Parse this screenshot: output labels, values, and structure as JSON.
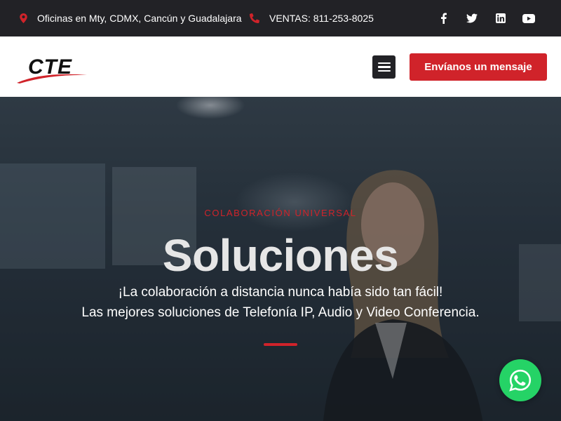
{
  "topbar": {
    "location_text": "Oficinas en Mty, CDMX, Cancún y Guadalajara",
    "phone_text": "VENTAS: 811-253-8025",
    "social": [
      "facebook-icon",
      "twitter-icon",
      "linkedin-icon",
      "youtube-icon"
    ]
  },
  "header": {
    "logo_text": "CTE",
    "cta_label": "Envíanos un mensaje"
  },
  "hero": {
    "eyebrow": "COLABORACIÓN UNIVERSAL",
    "title": "Soluciones",
    "line1": "¡La colaboración a distancia nunca había sido tan fácil!",
    "line2": "Las mejores soluciones de Telefonía IP, Audio y Video Conferencia."
  },
  "colors": {
    "accent": "#d0232a",
    "dark": "#222226",
    "whatsapp": "#25d366"
  }
}
